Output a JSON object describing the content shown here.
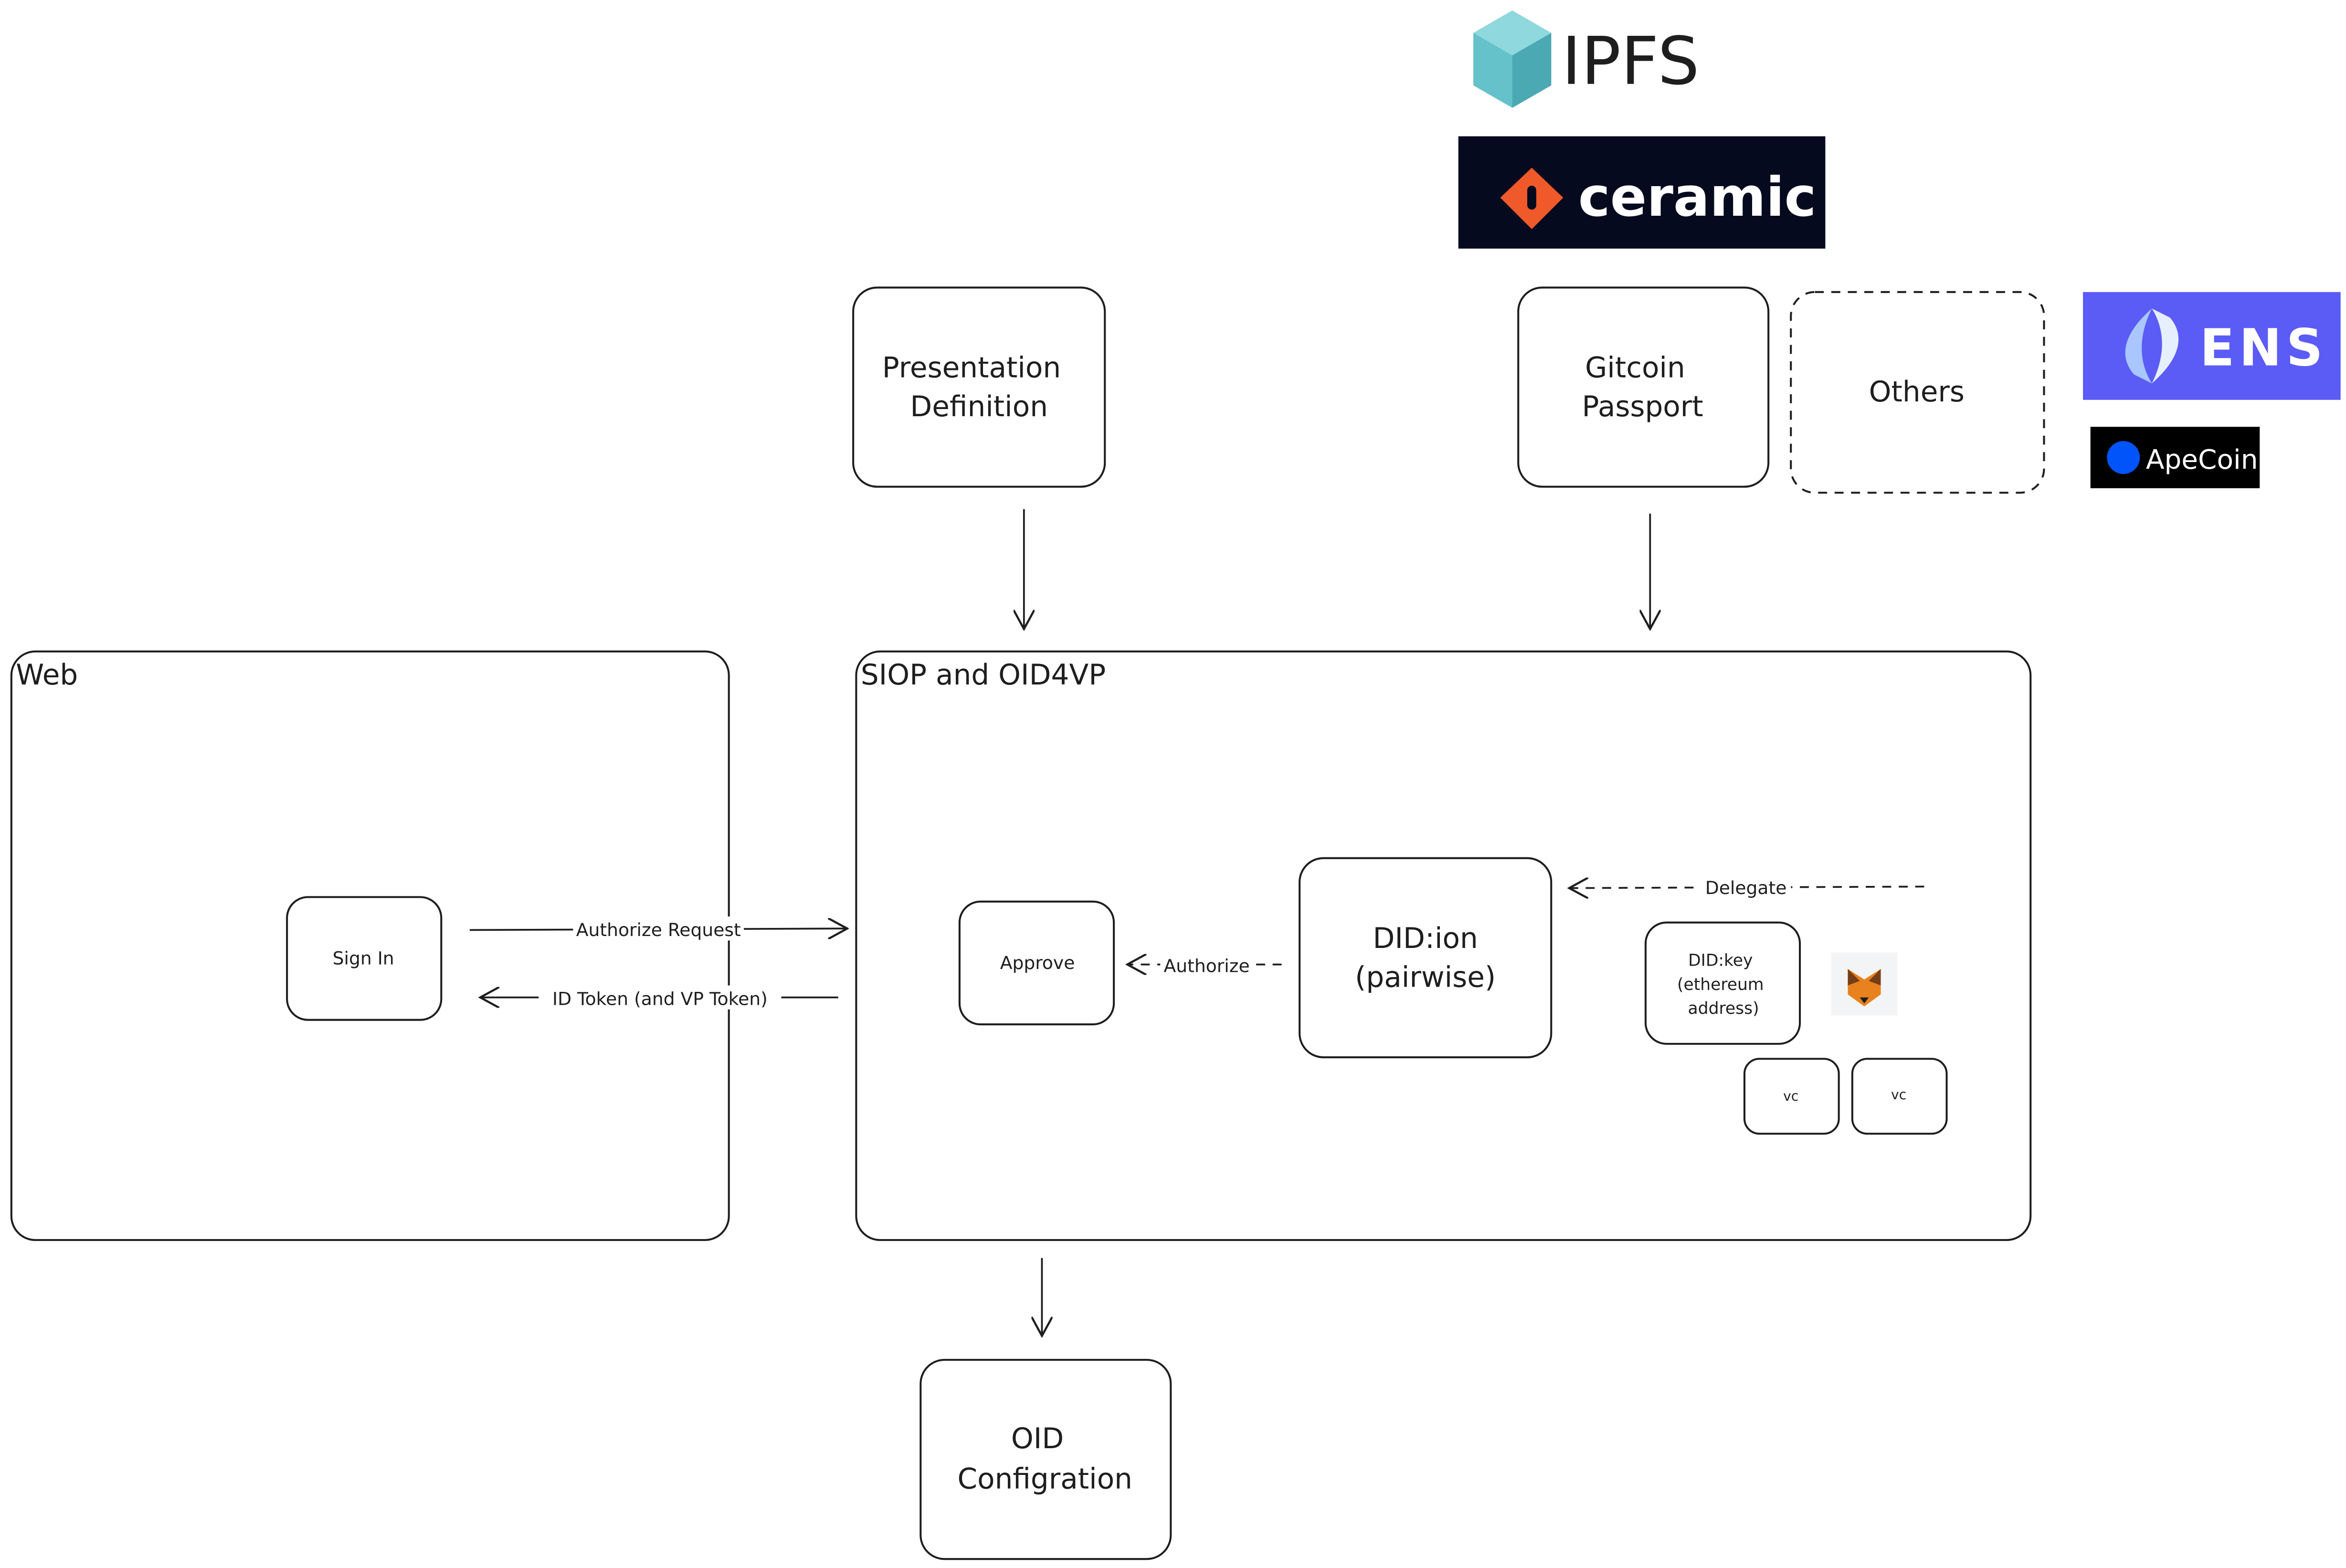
{
  "logos": {
    "ipfs": {
      "text": "IPFS",
      "color": "#65c2cb"
    },
    "ceramic": {
      "text": "ceramic",
      "bg": "#060a1f",
      "accent": "#f0592a"
    },
    "ens": {
      "text": "ENS",
      "bg": "#5b5bf6"
    },
    "apecoin": {
      "text": "ApeCoin",
      "bg": "#000000",
      "accent": "#0054f9"
    }
  },
  "boxes": {
    "presentation_definition": [
      "Presentation",
      "Definition"
    ],
    "gitcoin_passport": [
      "Gitcoin",
      "Passport"
    ],
    "others": "Others",
    "web": "Web",
    "siop": "SIOP and OID4VP",
    "sign_in": "Sign In",
    "approve": "Approve",
    "did_ion": [
      "DID:ion",
      "(pairwise)"
    ],
    "did_key": [
      "DID:key",
      "(ethereum",
      "address)"
    ],
    "vc1": "vc",
    "vc2": "vc",
    "oid_config": [
      "OID",
      "Configration"
    ]
  },
  "arrows": {
    "authorize_request": "Authorize Request",
    "id_token": "ID Token (and VP Token)",
    "authorize": "Authorize",
    "delegate": "Delegate"
  },
  "icons": {
    "metamask": "fox-icon"
  }
}
